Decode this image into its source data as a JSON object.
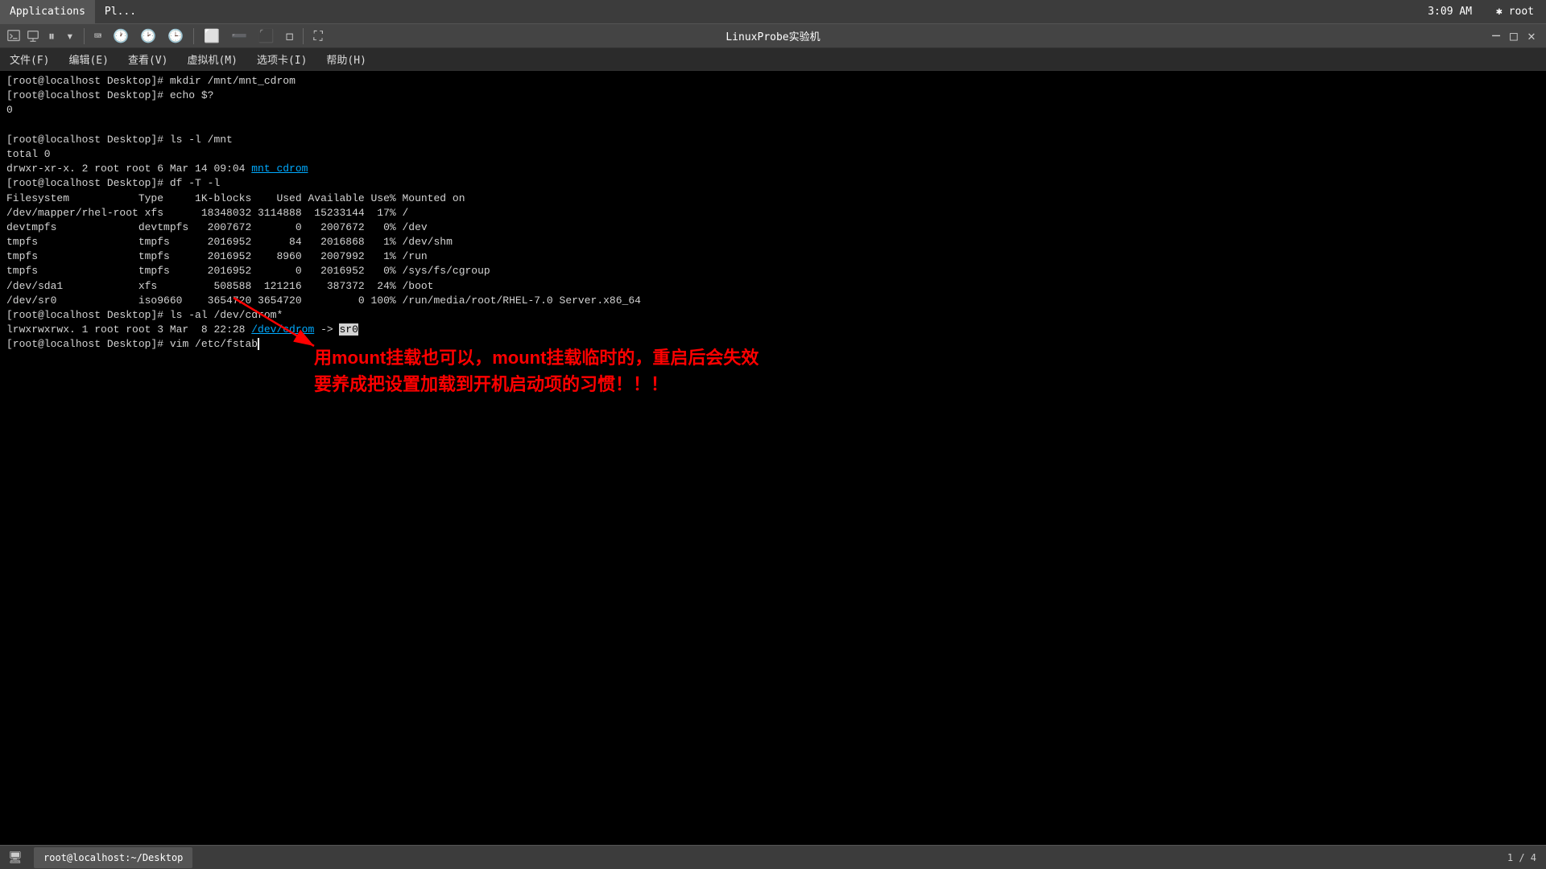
{
  "system_bar": {
    "apps_label": "Applications",
    "places_label": "Pl...",
    "time": "3:09 AM",
    "user": "✱ root"
  },
  "title_bar": {
    "title": "root@localhost:~/Desktop",
    "brand": "LinuxProbe实验机"
  },
  "menu_bar": {
    "items": [
      "文件(F)",
      "编辑(E)",
      "查看(V)",
      "虚拟机(M)",
      "选项卡(I)",
      "帮助(H)"
    ]
  },
  "terminal": {
    "lines": [
      "[root@localhost Desktop]# mkdir /mnt/mnt_cdrom",
      "[root@localhost Desktop]# echo $?",
      "0",
      "",
      "[root@localhost Desktop]# ls -l /mnt",
      "total 0",
      "drwxr-xr-x. 2 root root 6 Mar 14 09:04 mnt_cdrom",
      "[root@localhost Desktop]# df -T -l",
      "Filesystem           Type     1K-blocks    Used Available Use% Mounted on",
      "/dev/mapper/rhel-root xfs      18348032 3114888  15233144  17% /",
      "devtmpfs             devtmpfs   2007672       0   2007672   0% /dev",
      "tmpfs                tmpfs      2016952      84   2016868   1% /dev/shm",
      "tmpfs                tmpfs      2016952    8960   2007992   1% /run",
      "tmpfs                tmpfs      2016952       0   2016952   0% /sys/fs/cgroup",
      "/dev/sda1            xfs         508588  121216    387372  24% /boot",
      "/dev/sr0             iso9660    3654720 3654720         0 100% /run/media/root/RHEL-7.0 Server.x86_64",
      "[root@localhost Desktop]# ls -al /dev/cdrom*",
      "lrwxrwxrwx. 1 root root 3 Mar  8 22:28 /dev/cdrom -> sr0",
      "[root@localhost Desktop]# vim /etc/fstab"
    ],
    "mnt_cdrom_link": "mnt_cdrom",
    "cdrom_link": "/dev/cdrom",
    "sr0_highlight": "sr0",
    "cursor_text": ""
  },
  "annotation": {
    "text_line1": "用mount挂载也可以，mount挂载临时的，重启后会失效",
    "text_line2": "要养成把设置加载到开机启动项的习惯！！！"
  },
  "taskbar": {
    "app_label": "root@localhost:~/Desktop",
    "page_info": "1 / 4"
  }
}
